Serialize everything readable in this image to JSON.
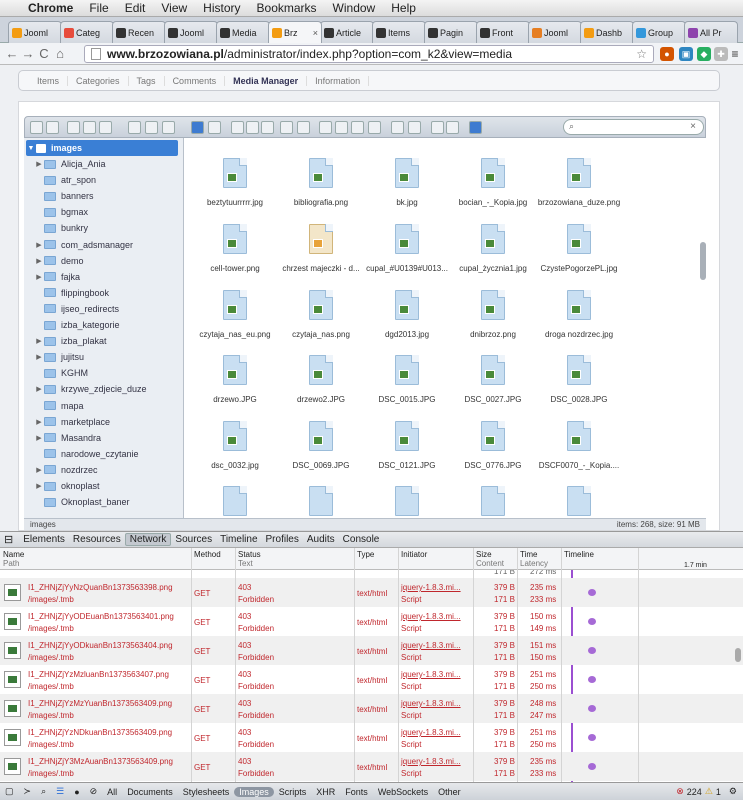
{
  "menubar": {
    "apple": "",
    "app": "Chrome",
    "items": [
      "File",
      "Edit",
      "View",
      "History",
      "Bookmarks",
      "Window",
      "Help"
    ]
  },
  "tabs": [
    {
      "label": "Jooml",
      "color": "#f39c12"
    },
    {
      "label": "Categ",
      "color": "#e74c3c"
    },
    {
      "label": "Recen",
      "color": "#333333"
    },
    {
      "label": "Jooml",
      "color": "#333333"
    },
    {
      "label": "Media",
      "color": "#333333"
    },
    {
      "label": "Brz",
      "color": "#f39c12"
    },
    {
      "label": "Article",
      "color": "#333333"
    },
    {
      "label": "Items",
      "color": "#333333"
    },
    {
      "label": "Pagin",
      "color": "#333333"
    },
    {
      "label": "Front",
      "color": "#333333"
    },
    {
      "label": "Jooml",
      "color": "#e67e22"
    },
    {
      "label": "Dashb",
      "color": "#f39c12"
    },
    {
      "label": "Group",
      "color": "#3498db"
    },
    {
      "label": "All Pr",
      "color": "#8e44ad"
    }
  ],
  "toolbar": {
    "back": "←",
    "forward": "→",
    "reload": "C",
    "home": "⌂",
    "url_domain": "www.brzozowiana.pl",
    "url_path": "/administrator/index.php?option=com_k2&view=media",
    "star": "☆",
    "menu": "≡"
  },
  "k2tabs": [
    "Items",
    "Categories",
    "Tags",
    "Comments",
    "Media Manager",
    "Information"
  ],
  "k2active": "Media Manager",
  "search": {
    "icon": "⌕",
    "clear": "×"
  },
  "tree": {
    "root": "images",
    "items": [
      {
        "label": "Alicja_Ania",
        "expand": true
      },
      {
        "label": "atr_spon",
        "expand": false
      },
      {
        "label": "banners",
        "expand": false
      },
      {
        "label": "bgmax",
        "expand": false
      },
      {
        "label": "bunkry",
        "expand": false
      },
      {
        "label": "com_adsmanager",
        "expand": true
      },
      {
        "label": "demo",
        "expand": true
      },
      {
        "label": "fajka",
        "expand": true
      },
      {
        "label": "flippingbook",
        "expand": false
      },
      {
        "label": "ijseo_redirects",
        "expand": false
      },
      {
        "label": "izba_kategorie",
        "expand": false
      },
      {
        "label": "izba_plakat",
        "expand": true
      },
      {
        "label": "jujitsu",
        "expand": true
      },
      {
        "label": "KGHM",
        "expand": false
      },
      {
        "label": "krzywe_zdjecie_duze",
        "expand": true
      },
      {
        "label": "mapa",
        "expand": false
      },
      {
        "label": "marketplace",
        "expand": true
      },
      {
        "label": "Masandra",
        "expand": true
      },
      {
        "label": "narodowe_czytanie",
        "expand": false
      },
      {
        "label": "nozdrzec",
        "expand": true
      },
      {
        "label": "oknoplast",
        "expand": true
      },
      {
        "label": "Oknoplast_baner",
        "expand": false
      }
    ]
  },
  "files": [
    {
      "name": "beztytuurrrrr.jpg",
      "type": "img"
    },
    {
      "name": "bibliografia.png",
      "type": "img"
    },
    {
      "name": "bk.jpg",
      "type": "img"
    },
    {
      "name": "bocian_-_Kopia.jpg",
      "type": "img"
    },
    {
      "name": "brzozowiana_duze.png",
      "type": "img"
    },
    {
      "name": "cell-tower.png",
      "type": "img"
    },
    {
      "name": "chrzest majeczki - d...",
      "type": "doc"
    },
    {
      "name": "cupal_#U0139#U013...",
      "type": "img"
    },
    {
      "name": "cupal_życznia1.jpg",
      "type": "img"
    },
    {
      "name": "CzystePogorzePL.jpg",
      "type": "img"
    },
    {
      "name": "czytaja_nas_eu.png",
      "type": "img"
    },
    {
      "name": "czytaja_nas.png",
      "type": "img"
    },
    {
      "name": "dgd2013.jpg",
      "type": "img"
    },
    {
      "name": "dnibrzoz.png",
      "type": "img"
    },
    {
      "name": "droga nozdrzec.jpg",
      "type": "img"
    },
    {
      "name": "drzewo.JPG",
      "type": "img"
    },
    {
      "name": "drzewo2.JPG",
      "type": "img"
    },
    {
      "name": "DSC_0015.JPG",
      "type": "img"
    },
    {
      "name": "DSC_0027.JPG",
      "type": "img"
    },
    {
      "name": "DSC_0028.JPG",
      "type": "img"
    },
    {
      "name": "dsc_0032.jpg",
      "type": "img"
    },
    {
      "name": "DSC_0069.JPG",
      "type": "img"
    },
    {
      "name": "DSC_0121.JPG",
      "type": "img"
    },
    {
      "name": "DSC_0776.JPG",
      "type": "img"
    },
    {
      "name": "DSCF0070_-_Kopia....",
      "type": "img"
    }
  ],
  "fmstatus": {
    "path": "images",
    "info": "items: 268, size: 91 MB"
  },
  "devtools": {
    "tabs": [
      "Elements",
      "Resources",
      "Network",
      "Sources",
      "Timeline",
      "Profiles",
      "Audits",
      "Console"
    ],
    "active": "Network",
    "headers": [
      {
        "main": "Name",
        "sub": "Path"
      },
      {
        "main": "Method",
        "sub": ""
      },
      {
        "main": "Status",
        "sub": "Text"
      },
      {
        "main": "Type",
        "sub": ""
      },
      {
        "main": "Initiator",
        "sub": ""
      },
      {
        "main": "Size",
        "sub": "Content"
      },
      {
        "main": "Time",
        "sub": "Latency"
      },
      {
        "main": "Timeline",
        "sub": ""
      }
    ],
    "timeline_scale": "1.7 min",
    "rows": [
      {
        "name": "I1_ZHNjZjYyNzQuanBn1373563398.png",
        "path": "/images/.tmb",
        "method": "GET",
        "status": "403",
        "text": "Forbidden",
        "type": "text/html",
        "init": "jquery-1.8.3.mi...",
        "init2": "Script",
        "size": "379 B",
        "content": "171 B",
        "time": "235 ms",
        "latency": "233 ms"
      },
      {
        "name": "I1_ZHNjZjYyODEuanBn1373563401.png",
        "path": "/images/.tmb",
        "method": "GET",
        "status": "403",
        "text": "Forbidden",
        "type": "text/html",
        "init": "jquery-1.8.3.mi...",
        "init2": "Script",
        "size": "379 B",
        "content": "171 B",
        "time": "150 ms",
        "latency": "149 ms"
      },
      {
        "name": "I1_ZHNjZjYyODkuanBn1373563404.png",
        "path": "/images/.tmb",
        "method": "GET",
        "status": "403",
        "text": "Forbidden",
        "type": "text/html",
        "init": "jquery-1.8.3.mi...",
        "init2": "Script",
        "size": "379 B",
        "content": "171 B",
        "time": "151 ms",
        "latency": "150 ms"
      },
      {
        "name": "I1_ZHNjZjYzMzluanBn1373563407.png",
        "path": "/images/.tmb",
        "method": "GET",
        "status": "403",
        "text": "Forbidden",
        "type": "text/html",
        "init": "jquery-1.8.3.mi...",
        "init2": "Script",
        "size": "379 B",
        "content": "171 B",
        "time": "251 ms",
        "latency": "250 ms"
      },
      {
        "name": "I1_ZHNjZjYzMzYuanBn1373563409.png",
        "path": "/images/.tmb",
        "method": "GET",
        "status": "403",
        "text": "Forbidden",
        "type": "text/html",
        "init": "jquery-1.8.3.mi...",
        "init2": "Script",
        "size": "379 B",
        "content": "171 B",
        "time": "248 ms",
        "latency": "247 ms"
      },
      {
        "name": "I1_ZHNjZjYzNDkuanBn1373563409.png",
        "path": "/images/.tmb",
        "method": "GET",
        "status": "403",
        "text": "Forbidden",
        "type": "text/html",
        "init": "jquery-1.8.3.mi...",
        "init2": "Script",
        "size": "379 B",
        "content": "171 B",
        "time": "251 ms",
        "latency": "250 ms"
      },
      {
        "name": "I1_ZHNjZjY3MzAuanBn1373563409.png",
        "path": "/images/.tmb",
        "method": "GET",
        "status": "403",
        "text": "Forbidden",
        "type": "text/html",
        "init": "jquery-1.8.3.mi...",
        "init2": "Script",
        "size": "379 B",
        "content": "171 B",
        "time": "235 ms",
        "latency": "233 ms"
      }
    ],
    "partial_row": {
      "size": "171 B",
      "time": "272 ms"
    },
    "bottom": [
      "All",
      "Documents",
      "Stylesheets",
      "Images",
      "Scripts",
      "XHR",
      "Fonts",
      "WebSockets",
      "Other"
    ],
    "bottom_active": "Images",
    "errors": "224",
    "warnings": "1"
  }
}
